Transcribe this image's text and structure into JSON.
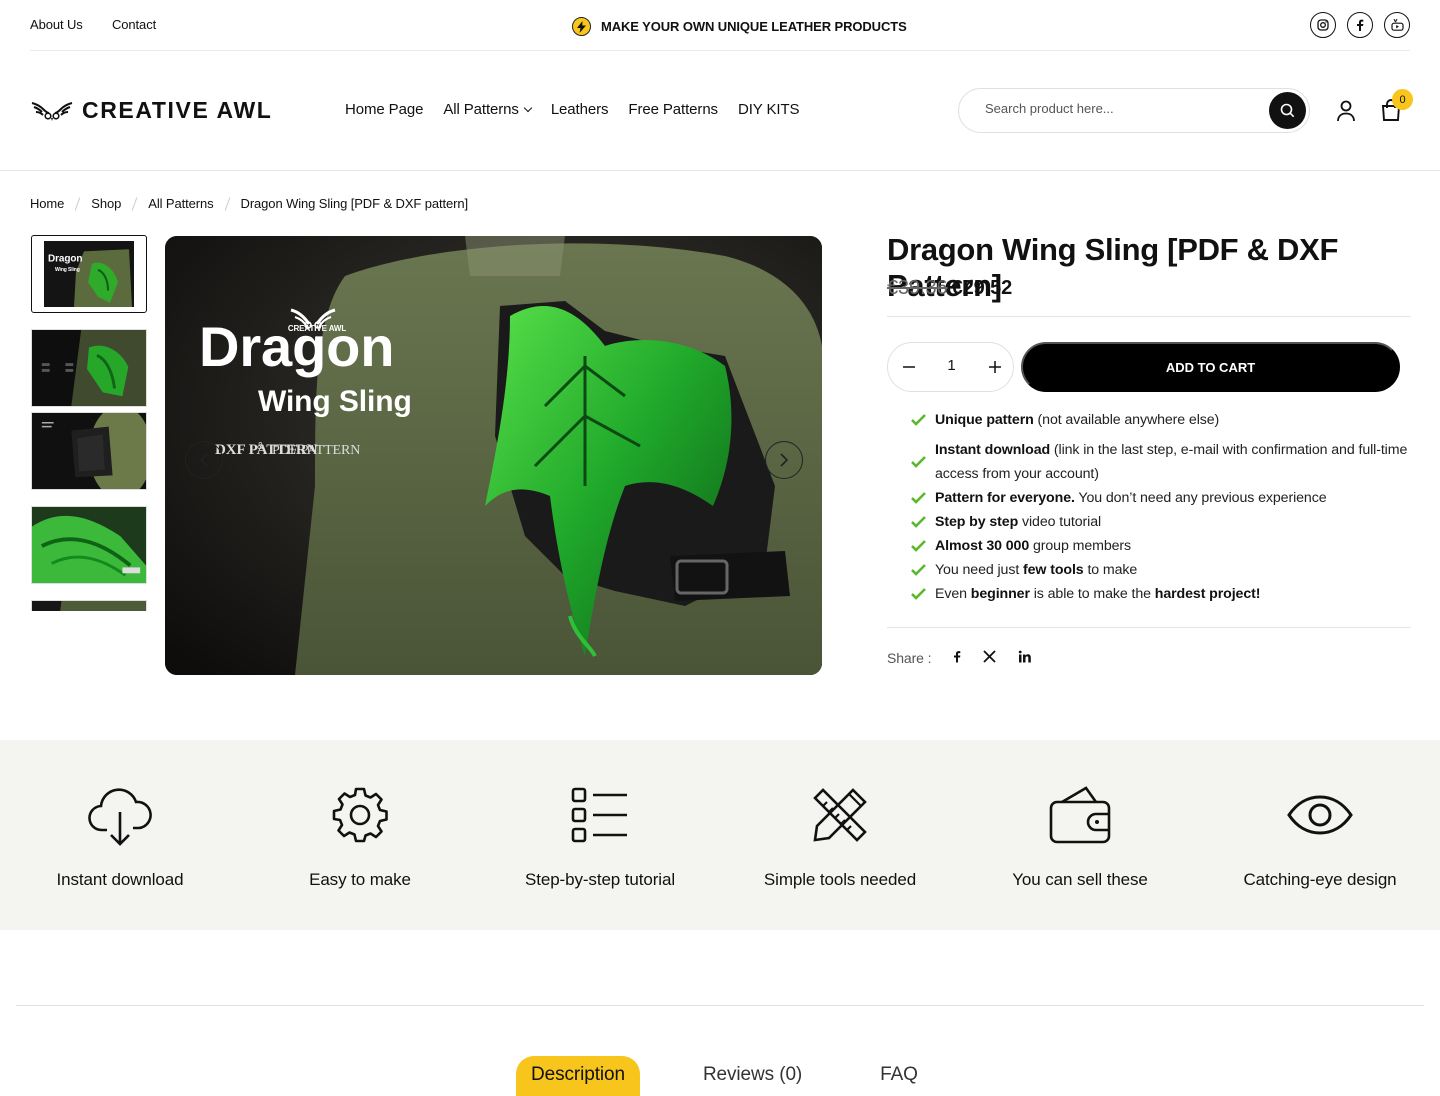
{
  "topbar": {
    "links": [
      "About Us",
      "Contact"
    ],
    "promo": "MAKE YOUR OWN UNIQUE LEATHER PRODUCTS",
    "social_icons": [
      "instagram-icon",
      "facebook-icon",
      "youtube-icon"
    ]
  },
  "header": {
    "logo": "CREATIVE AWL",
    "nav": [
      "Home Page",
      "All Patterns",
      "Leathers",
      "Free Patterns",
      "DIY KITS"
    ],
    "search_placeholder": "Search product here...",
    "cart_count": "0"
  },
  "breadcrumb": [
    "Home",
    "Shop",
    "All Patterns",
    "Dragon Wing Sling [PDF & DXF pattern]"
  ],
  "gallery": {
    "thumbnail_count": 5,
    "main_image": {
      "brand": "CREATIVE AWL",
      "title": "Dragon",
      "subtitle": "Wing Sling",
      "badge1": "DXF PATTERN",
      "badge_and": "&",
      "badge2": "PDF PATTERN"
    },
    "thumb_text": {
      "title": "Dragon",
      "subtitle": "Wing Sling"
    }
  },
  "product": {
    "title": "Dragon Wing Sling [PDF & DXF Pattern]",
    "old_price": "€39.36",
    "price": "€29.52",
    "quantity": "1",
    "add_to_cart": "ADD TO CART",
    "features": [
      {
        "bold": "Unique pattern",
        "text": " (not available anywhere else)"
      },
      {
        "bold": "Instant download",
        "text": " (link in the last step, e-mail with confirmation and full-time access from your account)"
      },
      {
        "bold": "Pattern for everyone.",
        "text": " You don’t need any previous experience"
      },
      {
        "bold": "Step by step",
        "text": " video tutorial"
      },
      {
        "bold": "Almost 30 000",
        "text": " group members"
      },
      {
        "pre": "You need just ",
        "bold": "few tools",
        "text": " to make"
      },
      {
        "pre": "Even ",
        "bold": "beginner",
        "text": " is able to make the ",
        "bold2": "hardest project!"
      }
    ],
    "share_label": "Share :",
    "share_icons": [
      "facebook-icon",
      "x-icon",
      "linkedin-icon"
    ]
  },
  "benefits": [
    {
      "label": "Instant download",
      "icon": "cloud-download-icon"
    },
    {
      "label": "Easy to make",
      "icon": "gear-icon"
    },
    {
      "label": "Step-by-step tutorial",
      "icon": "list-icon"
    },
    {
      "label": "Simple tools needed",
      "icon": "ruler-pencil-icon"
    },
    {
      "label": "You can sell these",
      "icon": "wallet-icon"
    },
    {
      "label": "Catching-eye design",
      "icon": "eye-icon"
    }
  ],
  "tabs": [
    "Description",
    "Reviews (0)",
    "FAQ"
  ],
  "colors": {
    "accent": "#f7c51c",
    "check": "#5cb82e",
    "band": "#f4f4f1"
  }
}
